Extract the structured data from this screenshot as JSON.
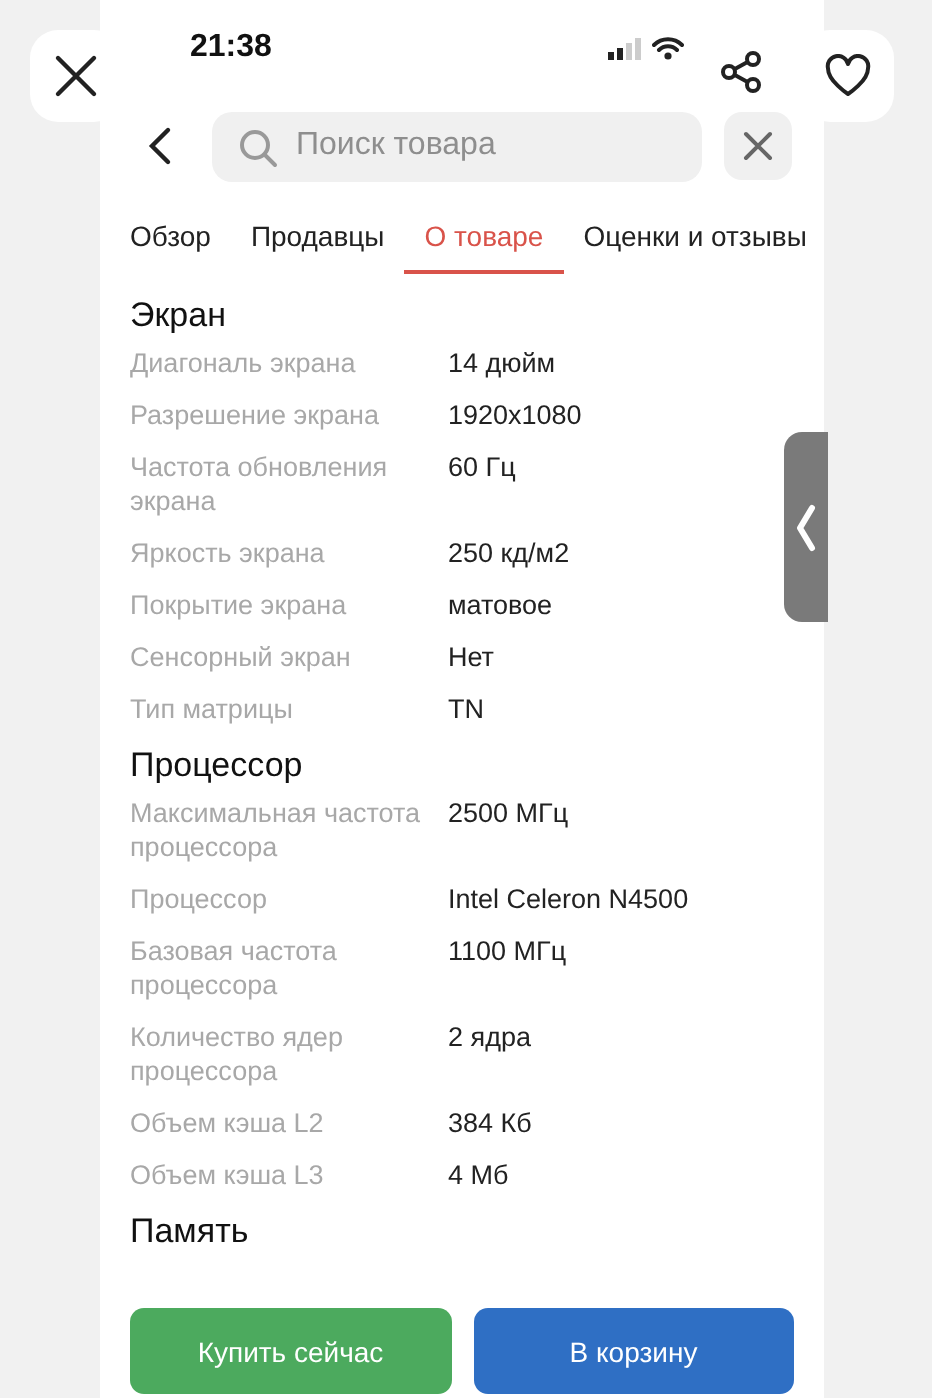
{
  "status_bar": {
    "time": "21:38"
  },
  "search": {
    "placeholder": "Поиск товара"
  },
  "tabs": [
    {
      "label": "Обзор",
      "selected": false
    },
    {
      "label": "Продавцы",
      "selected": false
    },
    {
      "label": "О товаре",
      "selected": true
    },
    {
      "label": "Оценки и отзывы",
      "selected": false
    }
  ],
  "sections": [
    {
      "title": "Экран",
      "specs": [
        {
          "label": "Диагональ экрана",
          "value": "14 дюйм"
        },
        {
          "label": "Разрешение экрана",
          "value": "1920x1080"
        },
        {
          "label": "Частота обновления экрана",
          "value": "60 Гц"
        },
        {
          "label": "Яркость экрана",
          "value": "250 кд/м2"
        },
        {
          "label": "Покрытие экрана",
          "value": "матовое"
        },
        {
          "label": "Сенсорный экран",
          "value": "Нет"
        },
        {
          "label": "Тип матрицы",
          "value": "TN"
        }
      ]
    },
    {
      "title": "Процессор",
      "specs": [
        {
          "label": "Максимальная частота процессора",
          "value": "2500 МГц"
        },
        {
          "label": "Процессор",
          "value": "Intel Celeron N4500"
        },
        {
          "label": "Базовая частота процессора",
          "value": "1100 МГц"
        },
        {
          "label": "Количество ядер процессора",
          "value": "2 ядра"
        },
        {
          "label": "Объем кэша L2",
          "value": "384 Кб"
        },
        {
          "label": "Объем кэша L3",
          "value": "4 Мб"
        }
      ]
    },
    {
      "title": "Память"
    }
  ],
  "buttons": [
    {
      "label": "Купить сейчас",
      "kind": "buy"
    },
    {
      "label": "В корзину",
      "kind": "cart"
    }
  ]
}
